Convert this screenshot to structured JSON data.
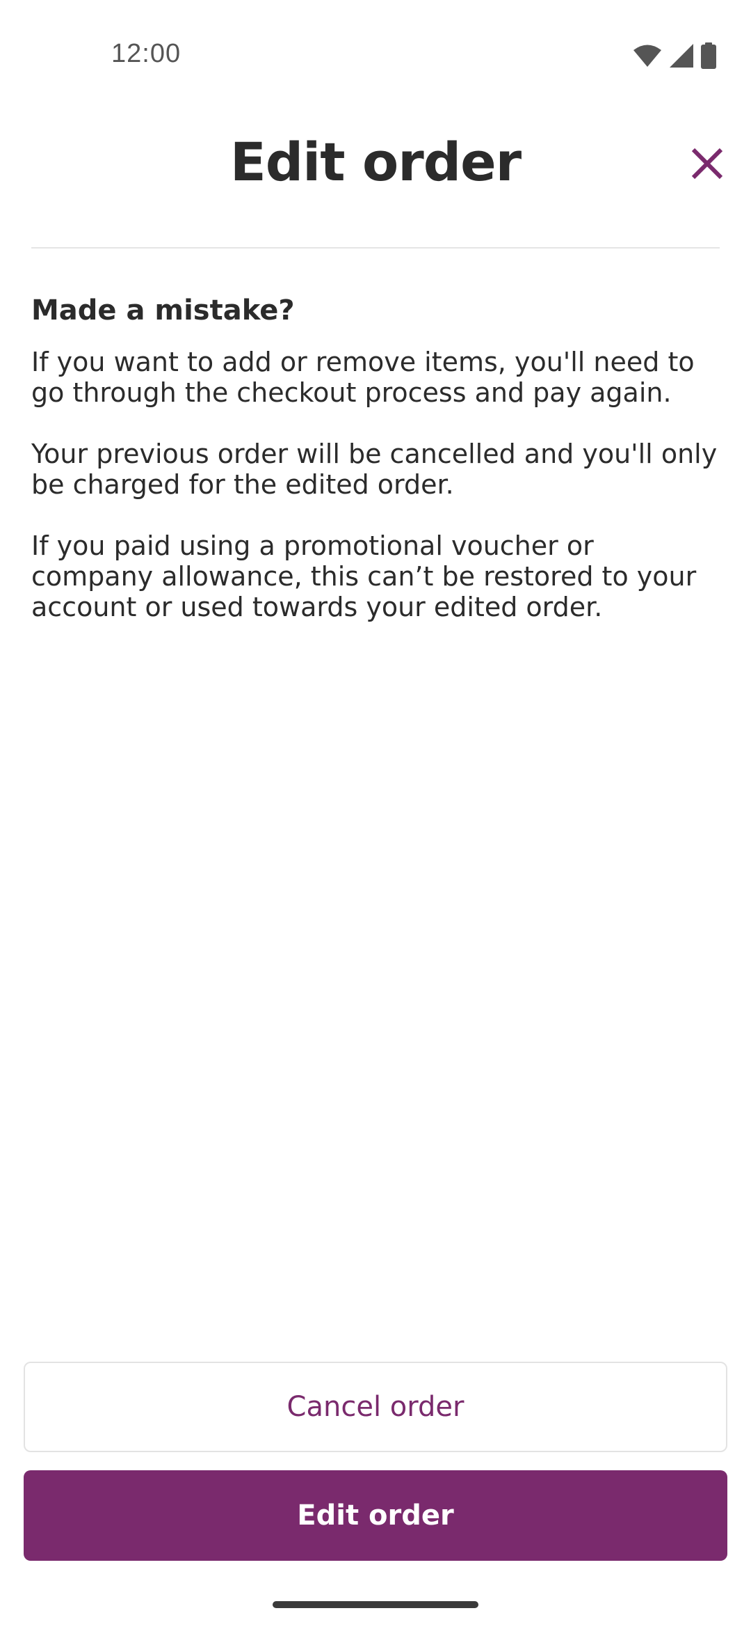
{
  "status_bar": {
    "time": "12:00",
    "icons": [
      "wifi-icon",
      "cellular-signal-icon",
      "battery-icon"
    ]
  },
  "header": {
    "title": "Edit order",
    "close_icon": "close-icon"
  },
  "content": {
    "heading": "Made a mistake?",
    "paragraphs": [
      "If you want to add or remove items, you'll need to go through the checkout process and pay again.",
      "Your previous order will be cancelled and you'll only be charged for the edited order.",
      "If you paid using a promotional voucher or company allowance, this can’t be restored to your account or used towards your edited order."
    ]
  },
  "actions": {
    "cancel_label": "Cancel order",
    "edit_label": "Edit order"
  },
  "colors": {
    "brand": "#7a2a6d",
    "text": "#2b2b2b",
    "divider": "#e5e5e5"
  }
}
